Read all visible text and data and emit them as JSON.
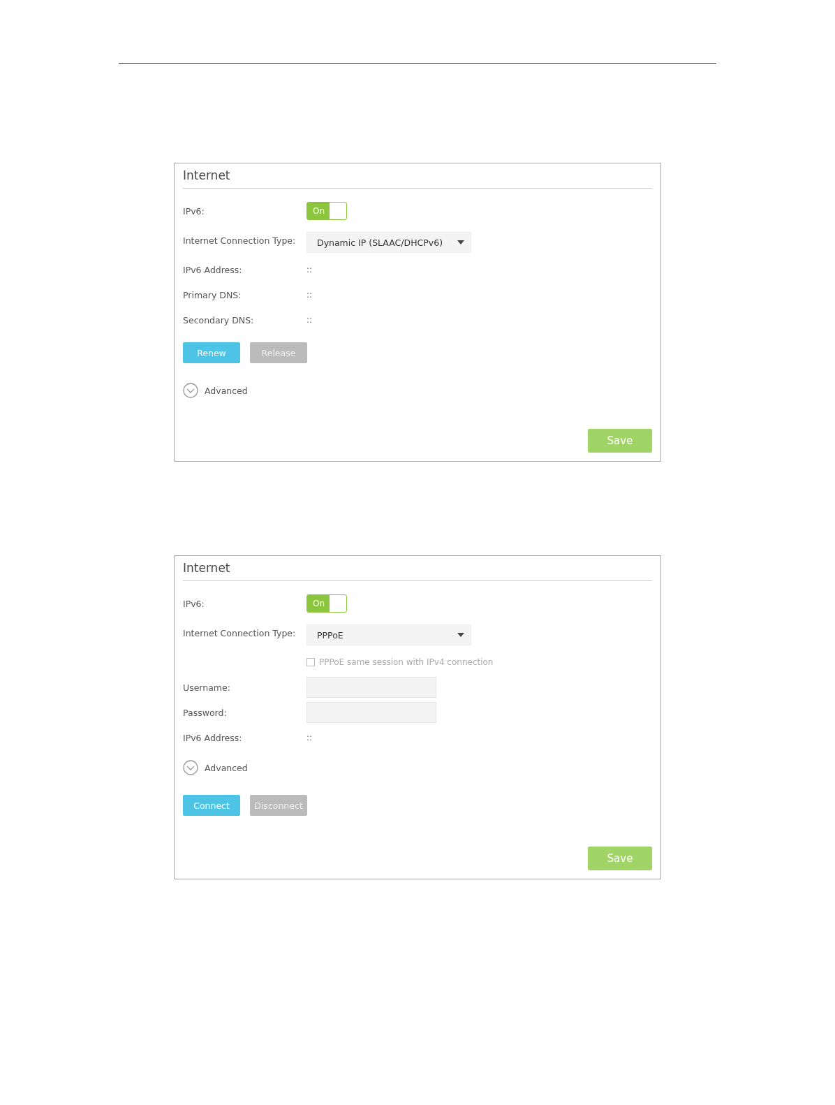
{
  "panels": [
    {
      "title": "Internet",
      "rows": [
        {
          "kind": "toggle",
          "label": "IPv6:",
          "toggle": {
            "text": "On",
            "on": true
          }
        },
        {
          "kind": "select",
          "label": "Internet Connection Type:",
          "value": "Dynamic IP (SLAAC/DHCPv6)"
        },
        {
          "kind": "value",
          "label": "IPv6 Address:",
          "value": "::"
        },
        {
          "kind": "value",
          "label": "Primary DNS:",
          "value": "::"
        },
        {
          "kind": "value",
          "label": "Secondary DNS:",
          "value": "::"
        },
        {
          "kind": "buttons",
          "buttons": [
            {
              "text": "Renew",
              "disabled": false
            },
            {
              "text": "Release",
              "disabled": true
            }
          ]
        },
        {
          "kind": "advanced",
          "label": "Advanced",
          "expanded": false
        }
      ],
      "save": "Save"
    },
    {
      "title": "Internet",
      "rows": [
        {
          "kind": "toggle",
          "label": "IPv6:",
          "toggle": {
            "text": "On",
            "on": true
          }
        },
        {
          "kind": "select",
          "label": "Internet Connection Type:",
          "value": "PPPoE"
        },
        {
          "kind": "checkbox",
          "label": "PPPoE same session with IPv4 connection",
          "checked": false,
          "disabled": true
        },
        {
          "kind": "input",
          "label": "Username:"
        },
        {
          "kind": "input",
          "label": "Password:"
        },
        {
          "kind": "value",
          "label": "IPv6 Address:",
          "value": "::"
        },
        {
          "kind": "advanced",
          "label": "Advanced",
          "expanded": false
        },
        {
          "kind": "buttons",
          "buttons": [
            {
              "text": "Connect",
              "disabled": false
            },
            {
              "text": "Disconnect",
              "disabled": true
            }
          ]
        }
      ],
      "save": "Save"
    }
  ]
}
